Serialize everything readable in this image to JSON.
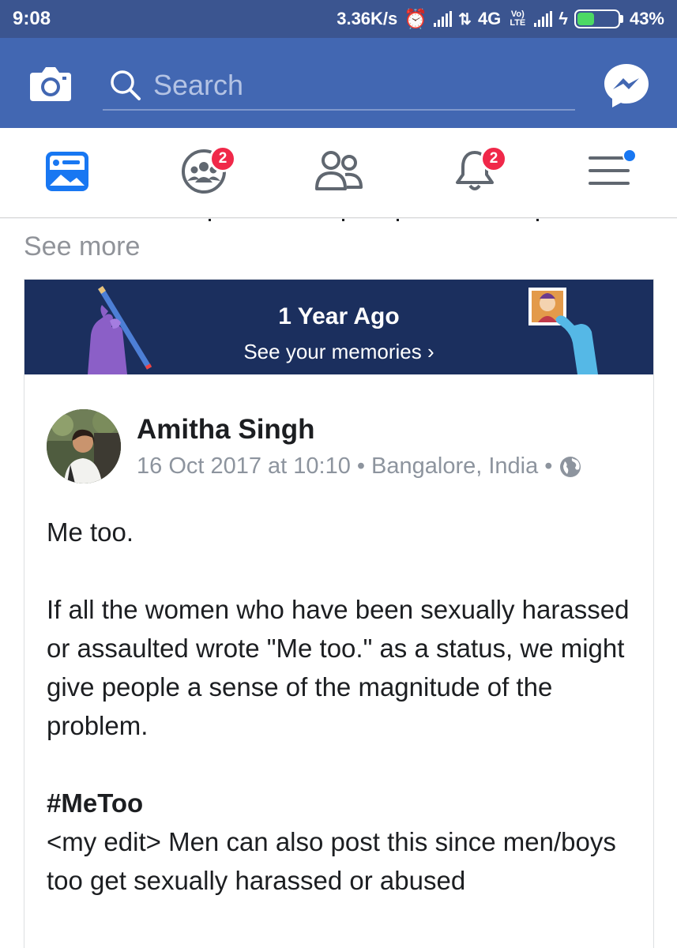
{
  "status_bar": {
    "time": "9:08",
    "speed": "3.36K/s",
    "network": "4G",
    "volte": "Vo) LTE",
    "battery": "43%",
    "battery_level": 0.43
  },
  "header": {
    "search_placeholder": "Search"
  },
  "tabs": {
    "groups_badge": "2",
    "notifications_badge": "2"
  },
  "feed": {
    "see_more": "See more"
  },
  "memory": {
    "title": "1 Year Ago",
    "link": "See your memories ›"
  },
  "post": {
    "author": "Amitha Singh",
    "date": "16 Oct 2017 at 10:10",
    "location": "Bangalore, India",
    "line1": "Me too.",
    "para2": "If all the women who have been sexually harassed or assaulted wrote \"Me too.\" as a status, we might give people a sense of the magnitude of the problem.",
    "hashtag": "#MeToo",
    "edit": "<my edit> Men can also post this since men/boys too get sexually harassed or abused"
  },
  "colors": {
    "header_blue": "#4267b2",
    "status_blue": "#3b5590",
    "badge_red": "#f02849",
    "banner_navy": "#1b2f5e"
  }
}
